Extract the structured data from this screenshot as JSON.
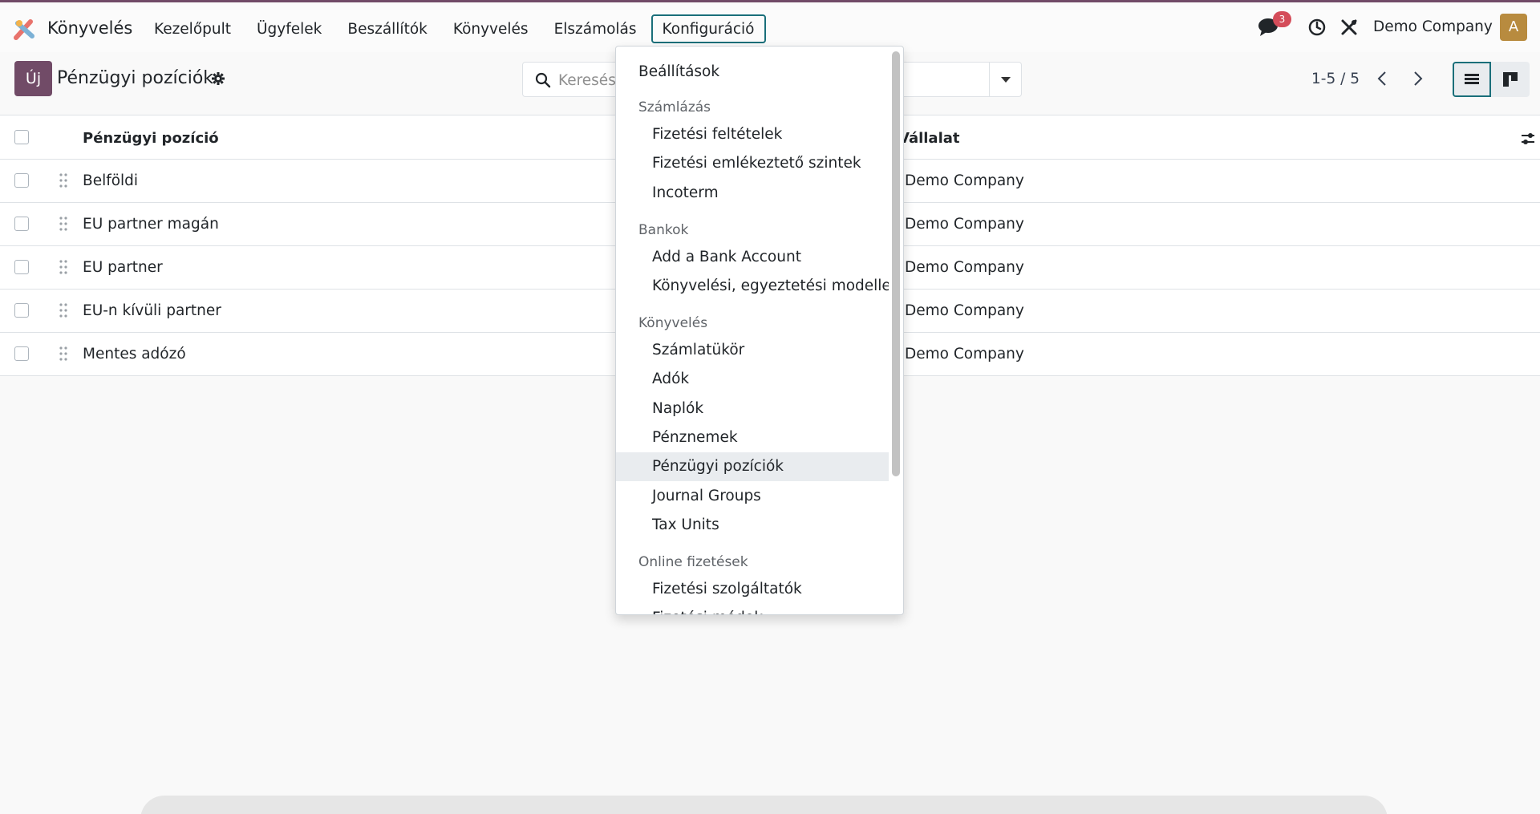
{
  "navbar": {
    "app_name": "Könyvelés",
    "menu": [
      {
        "label": "Kezelőpult"
      },
      {
        "label": "Ügyfelek"
      },
      {
        "label": "Beszállítók"
      },
      {
        "label": "Könyvelés"
      },
      {
        "label": "Elszámolás"
      },
      {
        "label": "Konfiguráció",
        "active": true
      }
    ],
    "chat_badge": "3",
    "company": "Demo Company",
    "avatar_letter": "A"
  },
  "control_panel": {
    "new_label": "Új",
    "title": "Pénzügyi pozíciók",
    "search_placeholder": "Keresés...",
    "pager": "1-5 / 5"
  },
  "table": {
    "columns": [
      "Pénzügyi pozíció",
      "Vállalat"
    ],
    "rows": [
      {
        "name": "Belföldi",
        "company": "Demo Company"
      },
      {
        "name": "EU partner magán",
        "company": "Demo Company"
      },
      {
        "name": "EU partner",
        "company": "Demo Company"
      },
      {
        "name": "EU-n kívüli partner",
        "company": "Demo Company"
      },
      {
        "name": "Mentes adózó",
        "company": "Demo Company"
      }
    ]
  },
  "dropdown": {
    "settings": "Beállítások",
    "sections": [
      {
        "header": "Számlázás",
        "items": [
          "Fizetési feltételek",
          "Fizetési emlékeztető szintek",
          "Incoterm"
        ]
      },
      {
        "header": "Bankok",
        "items": [
          "Add a Bank Account",
          "Könyvelési, egyeztetési modellek"
        ]
      },
      {
        "header": "Könyvelés",
        "items": [
          "Számlatükör",
          "Adók",
          "Naplók",
          "Pénznemek",
          "Pénzügyi pozíciók",
          "Journal Groups",
          "Tax Units"
        ]
      },
      {
        "header": "Online fizetések",
        "items": [
          "Fizetési szolgáltatók",
          "Fizetési módok"
        ]
      }
    ],
    "selected": "Pénzügyi pozíciók"
  },
  "colors": {
    "brand": "#714b67",
    "accent": "#1a6f7a",
    "badge": "#d44c59"
  }
}
